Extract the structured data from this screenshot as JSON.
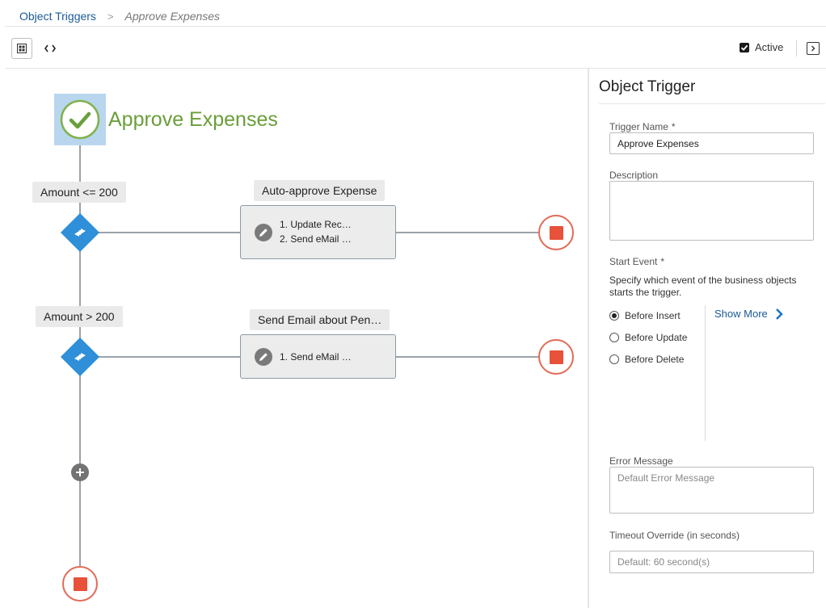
{
  "breadcrumb": {
    "root": "Object Triggers",
    "separator": ">",
    "current": "Approve Expenses"
  },
  "toolbar": {
    "active_label": "Active",
    "active_checked": true
  },
  "flow": {
    "title": "Approve Expenses",
    "branches": [
      {
        "condition": "Amount <= 200",
        "action_title": "Auto-approve Expense",
        "steps": [
          "1. Update Rec…",
          "2. Send eMail …"
        ]
      },
      {
        "condition": "Amount > 200",
        "action_title": "Send Email about Pen…",
        "steps": [
          "1. Send eMail …"
        ]
      }
    ]
  },
  "panel": {
    "title": "Object Trigger",
    "trigger_name": {
      "label": "Trigger Name",
      "required_mark": "*",
      "value": "Approve Expenses"
    },
    "description": {
      "label": "Description",
      "value": ""
    },
    "start_event": {
      "label": "Start Event",
      "required_mark": "*",
      "hint": "Specify which event of the business objects starts the trigger.",
      "options": [
        "Before Insert",
        "Before Update",
        "Before Delete"
      ],
      "selected": "Before Insert",
      "show_more": "Show More"
    },
    "error_message": {
      "label": "Error Message",
      "placeholder": "Default Error Message"
    },
    "timeout": {
      "label": "Timeout Override (in seconds)",
      "placeholder": "Default: 60 second(s)"
    }
  },
  "colors": {
    "accent": "#2f8fd8",
    "link": "#1a5a96",
    "title_green": "#6a9e3a",
    "stop_red": "#e8513a"
  }
}
